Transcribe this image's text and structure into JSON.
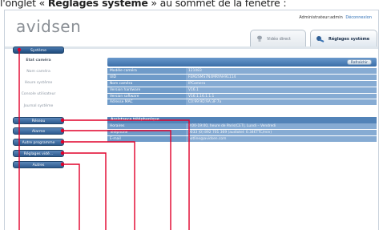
{
  "caption": {
    "prefix": "l'onglet « ",
    "bold": "Réglages système",
    "suffix": " » au sommet de la fenêtre :"
  },
  "header": {
    "logo": "avidsen",
    "user_text": "Administrateur:admin",
    "logout_label": "Déconnexion",
    "tabs": [
      {
        "label": "Vidéo direct",
        "icon": "camera-icon"
      },
      {
        "label": "Réglages système",
        "icon": "wrench-icon",
        "active": true
      }
    ]
  },
  "sidebar": {
    "system_label": "Système",
    "sub_items": [
      "Etat caméra",
      "Nom caméra",
      "Heure système",
      "Console utilisateur",
      "Journal système"
    ],
    "current_sub": "Etat caméra",
    "buttons": [
      "Réseau",
      "Alarme",
      "Autre programme",
      "Réglages vidé...",
      "Autres"
    ]
  },
  "content": {
    "refresh_label": "Rafraîchir",
    "camera_rows": [
      {
        "key": "Modèle caméra",
        "value": "121083"
      },
      {
        "key": "UID",
        "value": "FEM2SMS7N4MRYAH91114"
      },
      {
        "key": "Nom caméra",
        "value": "IPCamera"
      },
      {
        "key": "Version hardware",
        "value": "V16.1"
      },
      {
        "key": "Version software",
        "value": "V16.1.16.1.1.1"
      },
      {
        "key": "Adresse MAC",
        "value": "C0:99:9D:9A:3F:7a"
      }
    ],
    "assistance_title": "Assistance téléphonique",
    "assistance_rows": [
      {
        "key": "Horaires",
        "value": "9:00-19:00, heure de Paris(CET), Lundi – Vendredi"
      },
      {
        "key": "Téléphone",
        "value": "0033 (0) 892 701 369 (audiotel: 0.34€TTC/min)"
      },
      {
        "key": "E-mail",
        "value": "hotline@avidsen.com"
      }
    ]
  },
  "colors": {
    "accent_blue": "#3b6ea8",
    "callout_red": "#e0002a"
  }
}
